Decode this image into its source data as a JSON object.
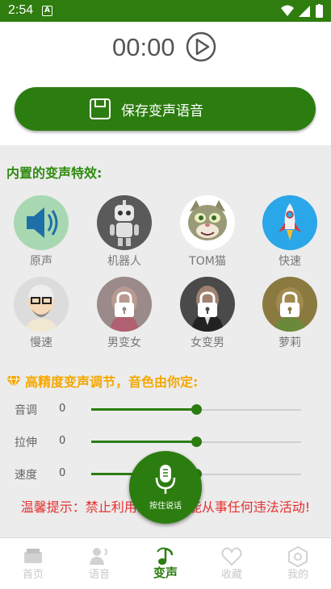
{
  "status_bar": {
    "time": "2:54",
    "notification_icon": "A"
  },
  "player": {
    "timer": "00:00",
    "play_icon": "play-circle-icon"
  },
  "save_button": {
    "label": "保存变声语音"
  },
  "effects": {
    "title": "内置的变声特效:",
    "items": [
      {
        "name": "原声",
        "icon": "speaker-icon",
        "locked": false
      },
      {
        "name": "机器人",
        "icon": "robot-icon",
        "locked": false
      },
      {
        "name": "TOM猫",
        "icon": "cat-icon",
        "locked": false
      },
      {
        "name": "快速",
        "icon": "rocket-icon",
        "locked": false
      },
      {
        "name": "慢速",
        "icon": "old-man-icon",
        "locked": true
      },
      {
        "name": "男变女",
        "icon": "male-to-female-icon",
        "locked": true
      },
      {
        "name": "女变男",
        "icon": "female-to-male-icon",
        "locked": true
      },
      {
        "name": "萝莉",
        "icon": "girl-icon",
        "locked": true
      }
    ]
  },
  "tuning": {
    "title": "高精度变声调节，音色由你定:",
    "sliders": [
      {
        "label": "音调",
        "value": "0",
        "level": 0.5
      },
      {
        "label": "拉伸",
        "value": "0",
        "level": 0.5
      },
      {
        "label": "速度",
        "value": "0",
        "level": 0.5
      }
    ]
  },
  "tip": {
    "text": "温馨提示：禁止利用本软件功能从事任何违法活动!"
  },
  "record_button": {
    "label": "按住说话"
  },
  "tabs": [
    {
      "label": "首页",
      "icon": "home-icon",
      "active": false
    },
    {
      "label": "语音",
      "icon": "voice-icon",
      "active": false
    },
    {
      "label": "变声",
      "icon": "music-note-icon",
      "active": true
    },
    {
      "label": "收藏",
      "icon": "heart-icon",
      "active": false
    },
    {
      "label": "我的",
      "icon": "hexagon-icon",
      "active": false
    }
  ],
  "colors": {
    "primary": "#2c7d10",
    "accent": "#f5a700",
    "warning": "#e53030"
  }
}
